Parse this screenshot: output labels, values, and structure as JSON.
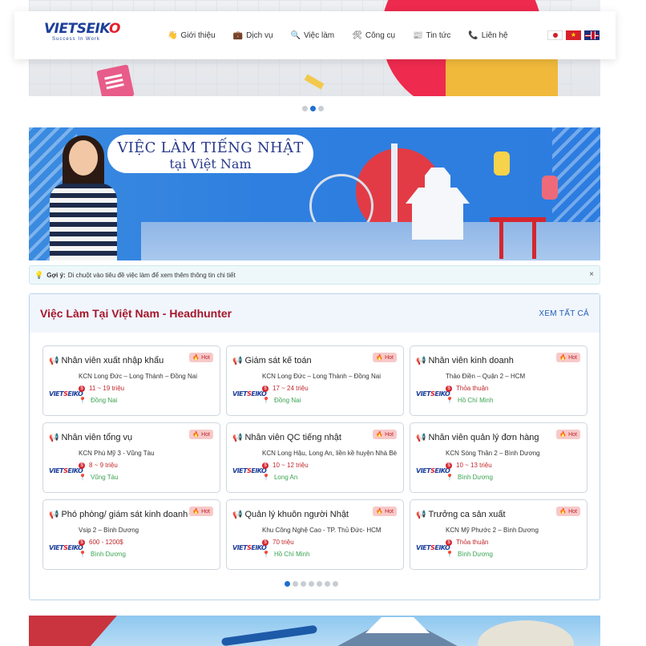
{
  "header": {
    "logo_text_a": "VIET",
    "logo_text_b": "SEIK",
    "logo_text_c": "O",
    "logo_tagline": "Success In Work",
    "nav": [
      {
        "icon": "hand-wave-icon",
        "glyph": "👋",
        "label": "Giới thiệu"
      },
      {
        "icon": "briefcase-icon",
        "glyph": "💼",
        "label": "Dịch vụ"
      },
      {
        "icon": "search-icon",
        "glyph": "🔍",
        "label": "Việc làm"
      },
      {
        "icon": "tools-icon",
        "glyph": "🛠",
        "label": "Công cụ"
      },
      {
        "icon": "newspaper-icon",
        "glyph": "📰",
        "label": "Tin tức"
      },
      {
        "icon": "phone-icon",
        "glyph": "📞",
        "label": "Liên hệ"
      }
    ]
  },
  "banner": {
    "line1": "VIỆC LÀM TIẾNG NHẬT",
    "line2": "tại Việt Nam"
  },
  "hint": {
    "label": "Gợi ý:",
    "text": "Di chuột vào tiêu đề việc làm để xem thêm thông tin chi tiết",
    "close": "×"
  },
  "jobs": {
    "title": "Việc Làm Tại Việt Nam - Headhunter",
    "see_all": "XEM TẤT CẢ",
    "hot_label": "Hot",
    "items": [
      {
        "title": "Nhân viên xuất nhập khẩu",
        "place": "KCN Long Đức – Long Thành – Đồng Nai",
        "salary": "11 ~ 19 triệu",
        "location": "Đồng Nai"
      },
      {
        "title": "Giám sát kế toán",
        "place": "KCN Long Đức – Long Thành – Đồng Nai",
        "salary": "17 ~ 24 triệu",
        "location": "Đồng Nai"
      },
      {
        "title": "Nhân viên kinh doanh",
        "place": "Thảo Điền – Quận 2 – HCM",
        "salary": "Thỏa thuận",
        "location": "Hồ Chí Minh"
      },
      {
        "title": "Nhân viên tổng vụ",
        "place": "KCN Phú Mỹ 3 - Vũng Tàu",
        "salary": "8 ~ 9 triệu",
        "location": "Vũng Tàu"
      },
      {
        "title": "Nhân viên QC tiếng nhật",
        "place": "KCN Long Hậu, Long An, liền kề huyện Nhà Bè",
        "salary": "10 ~ 12 triệu",
        "location": "Long An"
      },
      {
        "title": "Nhân viên quản lý đơn hàng",
        "place": "KCN Sóng Thần 2 – Bình Dương",
        "salary": "10 ~ 13 triệu",
        "location": "Bình Dương"
      },
      {
        "title": "Phó phòng/ giám sát kinh doanh",
        "place": "Vsip 2 – Bình Dương",
        "salary": "600 - 1200$",
        "location": "Bình Dương"
      },
      {
        "title": "Quản lý khuôn người Nhật",
        "place": "Khu Công Nghệ Cao - TP. Thủ Đức- HCM",
        "salary": "70 triệu",
        "location": "Hồ Chí Minh"
      },
      {
        "title": "Trưởng ca sản xuất",
        "place": "KCN Mỹ Phước 2 – Bình Dương",
        "salary": "Thỏa thuận",
        "location": "Bình Dương"
      }
    ],
    "pager_count": 7,
    "pager_active": 0
  },
  "hero_pager": {
    "count": 3,
    "active": 1
  },
  "colors": {
    "brand_blue": "#1d3f9b",
    "brand_red": "#e2202b",
    "title_red": "#a5162a",
    "salary_red": "#c0282b",
    "location_green": "#3aa351",
    "link_blue": "#1f5fb8"
  }
}
